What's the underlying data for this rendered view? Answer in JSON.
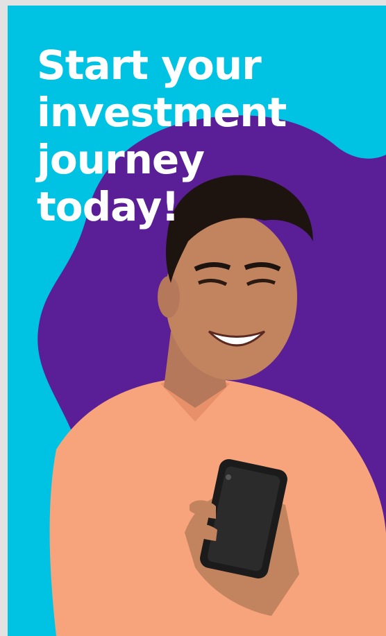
{
  "banner": {
    "headline_lines": [
      "Start your",
      "investment",
      "journey",
      "today!"
    ],
    "colors": {
      "background": "#00c3e3",
      "blob": "#5a1f96",
      "text": "#ffffff",
      "shirt": "#f7a47c",
      "phone": "#1b1b1b"
    }
  },
  "image": {
    "subject": "smiling-man-holding-phone-illustration"
  }
}
